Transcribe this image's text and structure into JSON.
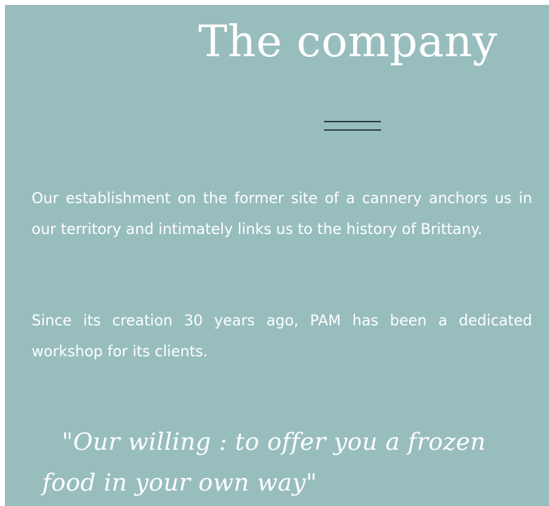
{
  "section": {
    "title": "The company",
    "paragraphs": [
      "Our establishment on the former site of a cannery anchors us in our territory and intimately links us to the history of Brittany.",
      "Since its creation 30 years ago, PAM has been a dedicated workshop for its clients."
    ],
    "quote": "\"Our willing : to offer you a frozen food in your own way\""
  },
  "colors": {
    "panel_background": "#98bdbd",
    "divider": "#2c3b45",
    "text": "#ffffff"
  }
}
